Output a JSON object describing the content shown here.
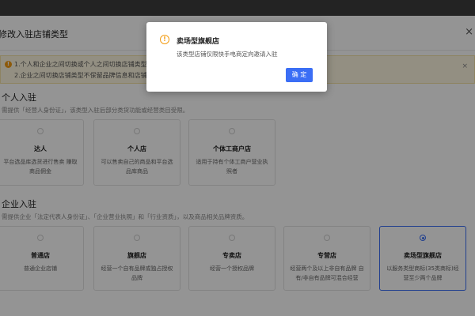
{
  "panel": {
    "title": "修改入驻店铺类型",
    "close": "×"
  },
  "notice": {
    "line1": "1.个人和企业之间切换或个人之间切换店铺类型不",
    "line2": "2.企业之间切换店铺类型不保留品牌信息和店铺名",
    "close": "×"
  },
  "personal": {
    "title": "个人入驻",
    "desc": "需提供「经营人身份证」，该类型入驻后部分类货功能或经营类目受限。",
    "cards": [
      {
        "name": "达人",
        "desc": "平台选品库选货进行售卖 赚取商品佣金",
        "selected": false
      },
      {
        "name": "个人店",
        "desc": "可以售卖自己的商品和平台选品库商品",
        "selected": false
      },
      {
        "name": "个体工商户店",
        "desc": "适用于持有个体工商户营业执照者",
        "selected": false
      }
    ]
  },
  "enterprise": {
    "title": "企业入驻",
    "desc": "需提供企业「法定代表人身份证」、「企业营业执照」和「行业资质」，以及商品相关品牌资质。",
    "cards": [
      {
        "name": "普通店",
        "desc": "普通企业店铺",
        "selected": false
      },
      {
        "name": "旗舰店",
        "desc": "经营一个自有品牌或独占授权品牌",
        "selected": false
      },
      {
        "name": "专卖店",
        "desc": "经营一个授权品牌",
        "selected": false
      },
      {
        "name": "专营店",
        "desc": "经营两个及以上非自有品牌 自有/非自有品牌可混合经营",
        "selected": false
      },
      {
        "name": "卖场型旗舰店",
        "desc": "以服务类型商标(35类商标)经营至少两个品牌",
        "selected": true
      }
    ]
  },
  "modal": {
    "icon": "!",
    "title": "卖场型旗舰店",
    "message": "该类型店铺仅限快手电商定向邀请入驻",
    "ok_label": "确 定"
  },
  "colors": {
    "primary": "#3b6ef5",
    "warning": "#f39c12",
    "notice_bg": "#fdf6e0"
  }
}
